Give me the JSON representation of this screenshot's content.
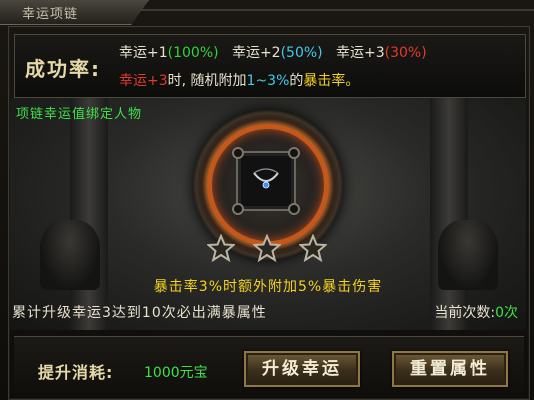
{
  "window": {
    "title": "幸运项链"
  },
  "info": {
    "label": "成功率:",
    "luck1": "幸运+1",
    "rate1": "(100%)",
    "luck2": "幸运+2",
    "rate2": "(50%)",
    "luck3": "幸运+3",
    "rate3": "(30%)",
    "bonus_luck": "幸运+3",
    "bonus_mid": "时, 随机附加",
    "bonus_range": "1~3%",
    "bonus_of": "的",
    "bonus_stat": "暴击率。"
  },
  "scene": {
    "bind_note": "项链幸运值绑定人物",
    "item_icon": "necklace-icon",
    "stars": 3,
    "crit_bonus": "暴击率3%时额外附加5%暴击伤害",
    "guarantee": "累计升级幸运3达到10次必出满暴属性",
    "count_label": "当前次数:",
    "count_value": "0次"
  },
  "footer": {
    "cost_label": "提升消耗:",
    "cost_value": "1000元宝",
    "upgrade_button": "升级幸运",
    "reset_button": "重置属性"
  },
  "colors": {
    "green": "#30d43a",
    "cyan": "#3ecbe8",
    "red": "#e03b2a",
    "yellow": "#f2d21e"
  }
}
